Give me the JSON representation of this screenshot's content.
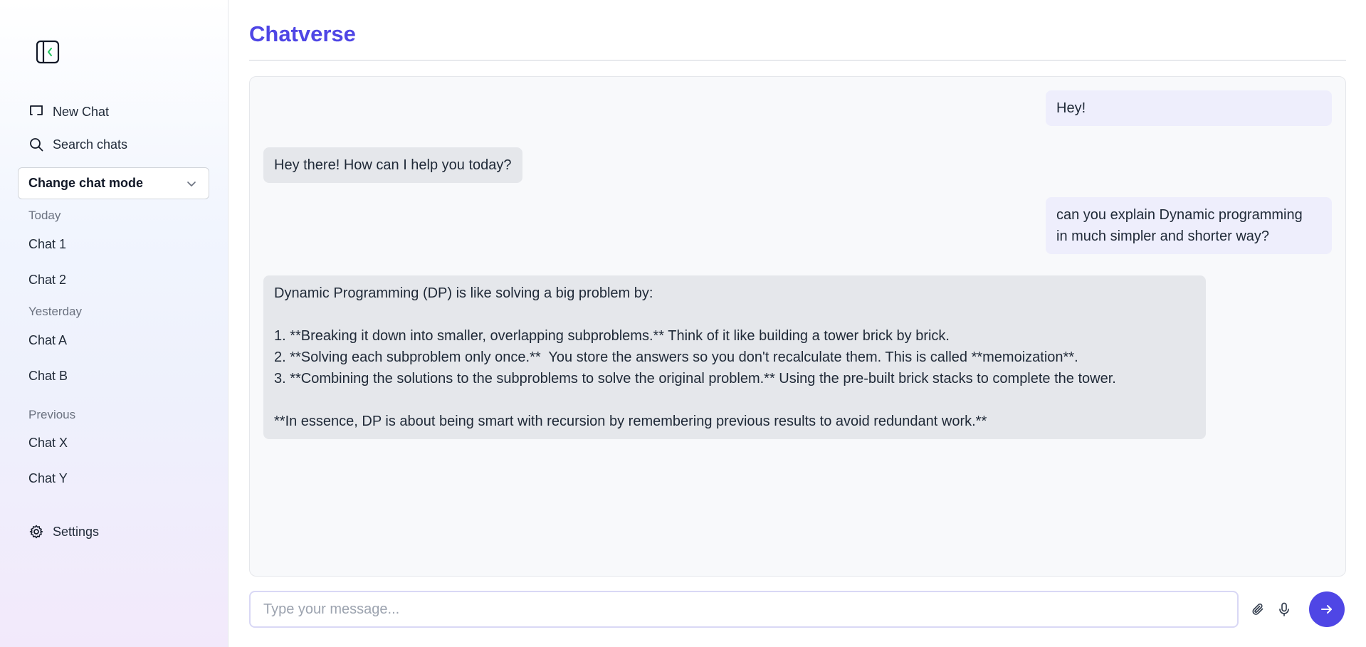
{
  "sidebar": {
    "new_chat_label": "New Chat",
    "search_label": "Search chats",
    "mode_select_label": "Change chat mode",
    "sections": {
      "today": "Today",
      "yesterday": "Yesterday",
      "previous": "Previous"
    },
    "chats": {
      "today": [
        "Chat 1",
        "Chat 2"
      ],
      "yesterday": [
        "Chat A",
        "Chat B"
      ],
      "previous": [
        "Chat X",
        "Chat Y"
      ]
    },
    "settings_label": "Settings"
  },
  "header": {
    "title": "Chatverse"
  },
  "messages": [
    {
      "role": "user",
      "text": "Hey!"
    },
    {
      "role": "assistant",
      "text": "Hey there! How can I help you today?"
    },
    {
      "role": "user",
      "text": "can you explain Dynamic programming\nin much simpler and shorter way?"
    },
    {
      "role": "assistant",
      "text": "Dynamic Programming (DP) is like solving a big problem by:\n\n1. **Breaking it down into smaller, overlapping subproblems.** Think of it like building a tower brick by brick.\n2. **Solving each subproblem only once.**  You store the answers so you don't recalculate them. This is called **memoization**.\n3. **Combining the solutions to the subproblems to solve the original problem.** Using the pre-built brick stacks to complete the tower.\n\n**In essence, DP is about being smart with recursion by remembering previous results to avoid redundant work.**"
    }
  ],
  "composer": {
    "placeholder": "Type your message...",
    "value": ""
  },
  "colors": {
    "accent": "#4f46e5",
    "user_bubble": "#eeeefc",
    "assistant_bubble": "#e5e7eb"
  },
  "icons": {
    "toggle": "sidebar-toggle-icon",
    "new_chat": "new-chat-icon",
    "search": "search-icon",
    "chevron": "chevron-down-icon",
    "settings": "gear-icon",
    "attach": "paperclip-icon",
    "mic": "microphone-icon",
    "send": "arrow-right-icon"
  }
}
